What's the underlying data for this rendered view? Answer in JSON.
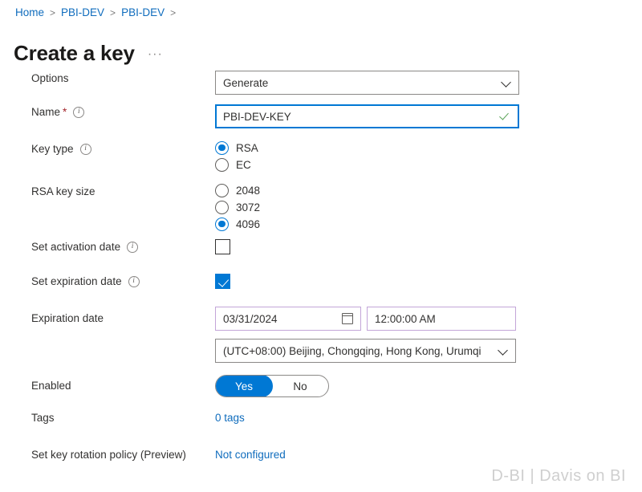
{
  "breadcrumb": {
    "items": [
      {
        "label": "Home"
      },
      {
        "label": "PBI-DEV"
      },
      {
        "label": "PBI-DEV"
      }
    ],
    "separator": ">"
  },
  "header": {
    "title": "Create a key",
    "more_menu": "···"
  },
  "form": {
    "options": {
      "label": "Options",
      "value": "Generate",
      "chevron_icon": "chevron-down-icon"
    },
    "name": {
      "label": "Name",
      "required_marker": "*",
      "info_icon": "i",
      "value": "PBI-DEV-KEY",
      "placeholder": "",
      "validation_icon": "checkmark-valid-icon"
    },
    "key_type": {
      "label": "Key type",
      "info_icon": "i",
      "options": [
        {
          "label": "RSA",
          "selected": true
        },
        {
          "label": "EC",
          "selected": false
        }
      ]
    },
    "rsa_key_size": {
      "label": "RSA key size",
      "options": [
        {
          "label": "2048",
          "selected": false
        },
        {
          "label": "3072",
          "selected": false
        },
        {
          "label": "4096",
          "selected": true
        }
      ]
    },
    "set_activation_date": {
      "label": "Set activation date",
      "info_icon": "i",
      "checked": false
    },
    "set_expiration_date": {
      "label": "Set expiration date",
      "info_icon": "i",
      "checked": true
    },
    "expiration_date": {
      "label": "Expiration date",
      "date_value": "03/31/2024",
      "calendar_icon": "calendar-icon",
      "time_value": "12:00:00 AM",
      "timezone_value": "(UTC+08:00) Beijing, Chongqing, Hong Kong, Urumqi",
      "chevron_icon": "chevron-down-icon"
    },
    "enabled": {
      "label": "Enabled",
      "yes_label": "Yes",
      "no_label": "No",
      "value": "Yes"
    },
    "tags": {
      "label": "Tags",
      "link_text": "0 tags"
    },
    "key_rotation_policy": {
      "label": "Set key rotation policy (Preview)",
      "link_text": "Not configured"
    }
  },
  "watermark": {
    "text": "D-BI | Davis on BI"
  },
  "colors": {
    "accent": "#0078d4",
    "link": "#0f6cbd",
    "required": "#a4262c",
    "valid": "#5aa358",
    "violet_border": "#c3a5d8",
    "border": "#8a8886"
  }
}
